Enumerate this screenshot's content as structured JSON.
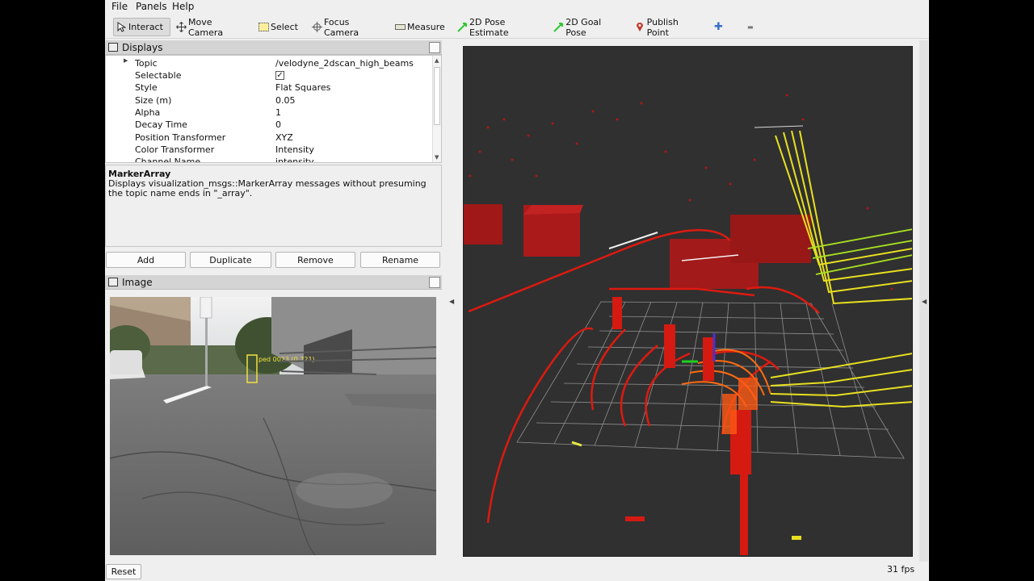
{
  "menu": [
    "File",
    "Panels",
    "Help"
  ],
  "toolbar": {
    "tools": [
      {
        "label": "Interact",
        "icon": "pointer-icon"
      },
      {
        "label": "Move Camera",
        "icon": "move-icon"
      },
      {
        "label": "Select",
        "icon": "select-icon"
      },
      {
        "label": "Focus Camera",
        "icon": "target-icon"
      },
      {
        "label": "Measure",
        "icon": "ruler-icon"
      },
      {
        "label": "2D Pose Estimate",
        "icon": "arrow-icon"
      },
      {
        "label": "2D Goal Pose",
        "icon": "arrow-icon"
      },
      {
        "label": "Publish Point",
        "icon": "marker-icon"
      }
    ],
    "add_symbol": "✚",
    "remove_symbol": "▬"
  },
  "displays": {
    "title": "Displays",
    "properties": [
      {
        "key": "Topic",
        "value": "/velodyne_2dscan_high_beams"
      },
      {
        "key": "Selectable",
        "value": "✓"
      },
      {
        "key": "Style",
        "value": "Flat Squares"
      },
      {
        "key": "Size (m)",
        "value": "0.05"
      },
      {
        "key": "Alpha",
        "value": "1"
      },
      {
        "key": "Decay Time",
        "value": "0"
      },
      {
        "key": "Position Transformer",
        "value": "XYZ"
      },
      {
        "key": "Color Transformer",
        "value": "Intensity"
      },
      {
        "key": "Channel Name",
        "value": "intensity"
      }
    ]
  },
  "description": {
    "title": "MarkerArray",
    "text": "Displays visualization_msgs::MarkerArray messages without presuming the topic name ends in \"_array\"."
  },
  "buttons": {
    "add": "Add",
    "duplicate": "Duplicate",
    "remove": "Remove",
    "rename": "Rename"
  },
  "image_panel": {
    "title": "Image",
    "overlay_label": "ped 0023 (0.721)"
  },
  "status": {
    "reset": "Reset",
    "fps": "31 fps"
  }
}
